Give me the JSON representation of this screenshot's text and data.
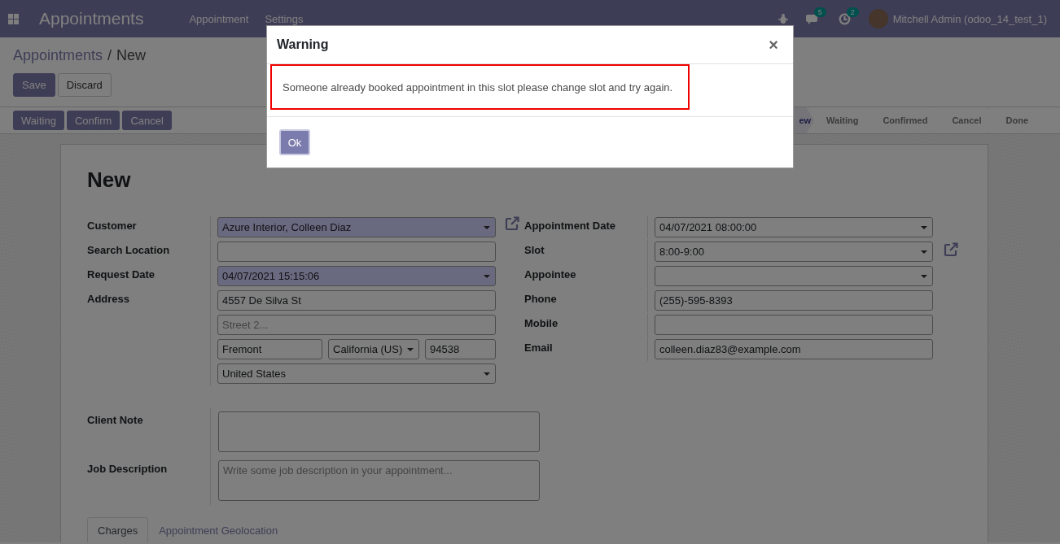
{
  "navbar": {
    "app": "Appointments",
    "menus": [
      "Appointment",
      "Settings"
    ],
    "messages_count": "5",
    "activities_count": "2",
    "user": "Mitchell Admin (odoo_14_test_1)"
  },
  "breadcrumb": [
    "Appointments",
    "New"
  ],
  "breadcrumb_separator": "/",
  "buttons": [
    {
      "label": "Save",
      "kind": "primary"
    },
    {
      "label": "Discard",
      "kind": "secondary"
    }
  ],
  "header_buttons": [
    "Waiting",
    "Confirm",
    "Cancel"
  ],
  "stages": [
    {
      "label": "ew",
      "selected": true
    },
    {
      "label": "Waiting",
      "selected": false
    },
    {
      "label": "Confirmed",
      "selected": false
    },
    {
      "label": "Cancel",
      "selected": false
    },
    {
      "label": "Done",
      "selected": false
    }
  ],
  "form": {
    "title": "New",
    "left_fields": [
      {
        "label": "Customer",
        "link": true,
        "rows": [
          [
            {
              "kind": "select",
              "value": "Azure Interior, Colleen Diaz",
              "required": true
            }
          ]
        ]
      },
      {
        "label": "Search Location",
        "link": false,
        "rows": [
          [
            {
              "kind": "text",
              "required": false
            }
          ]
        ]
      },
      {
        "label": "Request Date",
        "link": false,
        "rows": [
          [
            {
              "kind": "select",
              "value": "04/07/2021 15:15:06",
              "required": true
            }
          ]
        ]
      },
      {
        "label": "Address",
        "link": false,
        "rows": [
          [
            {
              "kind": "text",
              "value": "4557 De Silva St",
              "required": false
            }
          ],
          [
            {
              "kind": "text",
              "placeholder": "Street 2...",
              "required": false
            }
          ],
          [
            {
              "kind": "text",
              "value": "Fremont",
              "required": false
            },
            {
              "kind": "select",
              "value": "California (US)",
              "required": false
            },
            {
              "kind": "text",
              "value": "94538",
              "required": false
            }
          ],
          [
            {
              "kind": "select",
              "value": "United States",
              "required": false
            }
          ]
        ]
      }
    ],
    "right_fields": [
      {
        "label": "Appointment Date",
        "link": false,
        "rows": [
          [
            {
              "kind": "select",
              "value": "04/07/2021 08:00:00",
              "required": false
            }
          ]
        ]
      },
      {
        "label": "Slot",
        "link": true,
        "rows": [
          [
            {
              "kind": "select",
              "value": "8:00-9:00",
              "required": false
            }
          ]
        ]
      },
      {
        "label": "Appointee",
        "link": false,
        "rows": [
          [
            {
              "kind": "select",
              "required": false
            }
          ]
        ]
      },
      {
        "label": "Phone",
        "link": false,
        "rows": [
          [
            {
              "kind": "text",
              "value": "(255)-595-8393",
              "required": false
            }
          ]
        ]
      },
      {
        "label": "Mobile",
        "link": false,
        "rows": [
          [
            {
              "kind": "text",
              "required": false
            }
          ]
        ]
      },
      {
        "label": "Email",
        "link": false,
        "rows": [
          [
            {
              "kind": "text",
              "value": "colleen.diaz83@example.com",
              "required": false
            }
          ]
        ]
      }
    ],
    "notes": [
      {
        "label": "Client Note"
      },
      {
        "label": "Job Description",
        "placeholder": "Write some job description in your appointment..."
      }
    ],
    "tabs": [
      {
        "label": "Charges",
        "selected": true
      },
      {
        "label": "Appointment Geolocation",
        "selected": false
      }
    ]
  },
  "dialog": {
    "title": "Warning",
    "close": "×",
    "message": "Someone already booked appointment in this slot please change slot and try again.",
    "button": "Ok"
  }
}
